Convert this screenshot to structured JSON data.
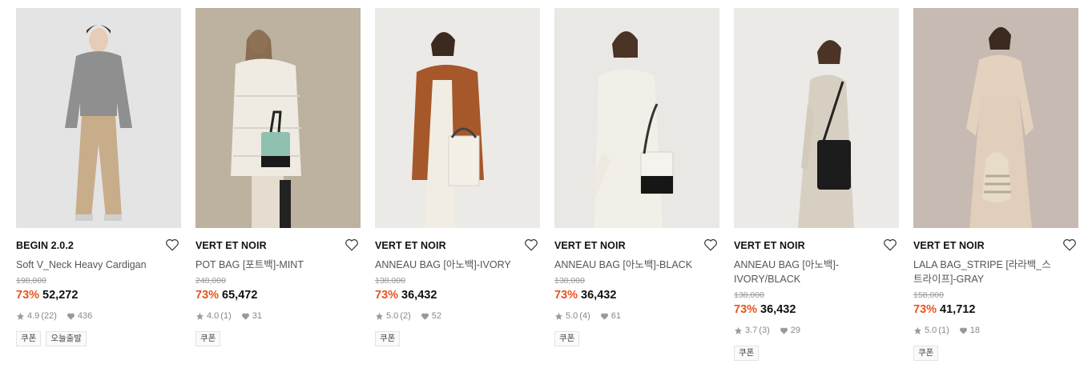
{
  "products": [
    {
      "brand": "BEGIN 2.0.2",
      "name": "Soft V_Neck Heavy Cardigan",
      "original_price": "198,000",
      "discount": "73%",
      "price": "52,272",
      "rating": "4.9",
      "reviews": "(22)",
      "likes": "436",
      "tags": [
        "쿠폰",
        "오늘출발"
      ]
    },
    {
      "brand": "VERT ET NOIR",
      "name": "POT BAG [포트백]-MINT",
      "original_price": "248,000",
      "discount": "73%",
      "price": "65,472",
      "rating": "4.0",
      "reviews": "(1)",
      "likes": "31",
      "tags": [
        "쿠폰"
      ]
    },
    {
      "brand": "VERT ET NOIR",
      "name": "ANNEAU BAG [아노백]-IVORY",
      "original_price": "138,000",
      "discount": "73%",
      "price": "36,432",
      "rating": "5.0",
      "reviews": "(2)",
      "likes": "52",
      "tags": [
        "쿠폰"
      ]
    },
    {
      "brand": "VERT ET NOIR",
      "name": "ANNEAU BAG [아노백]-BLACK",
      "original_price": "138,000",
      "discount": "73%",
      "price": "36,432",
      "rating": "5.0",
      "reviews": "(4)",
      "likes": "61",
      "tags": [
        "쿠폰"
      ]
    },
    {
      "brand": "VERT ET NOIR",
      "name": "ANNEAU BAG [아노백]-IVORY/BLACK",
      "original_price": "138,000",
      "discount": "73%",
      "price": "36,432",
      "rating": "3.7",
      "reviews": "(3)",
      "likes": "29",
      "tags": [
        "쿠폰"
      ]
    },
    {
      "brand": "VERT ET NOIR",
      "name": "LALA BAG_STRIPE [라라백_스트라이프]-GRAY",
      "original_price": "158,000",
      "discount": "73%",
      "price": "41,712",
      "rating": "5.0",
      "reviews": "(1)",
      "likes": "18",
      "tags": [
        "쿠폰"
      ]
    }
  ],
  "icons": {
    "wishlist": "heart-outline-icon",
    "rating": "star-icon",
    "likes": "heart-icon"
  },
  "colors": {
    "discount": "#e8531f",
    "price": "#111111",
    "muted": "#999999"
  }
}
